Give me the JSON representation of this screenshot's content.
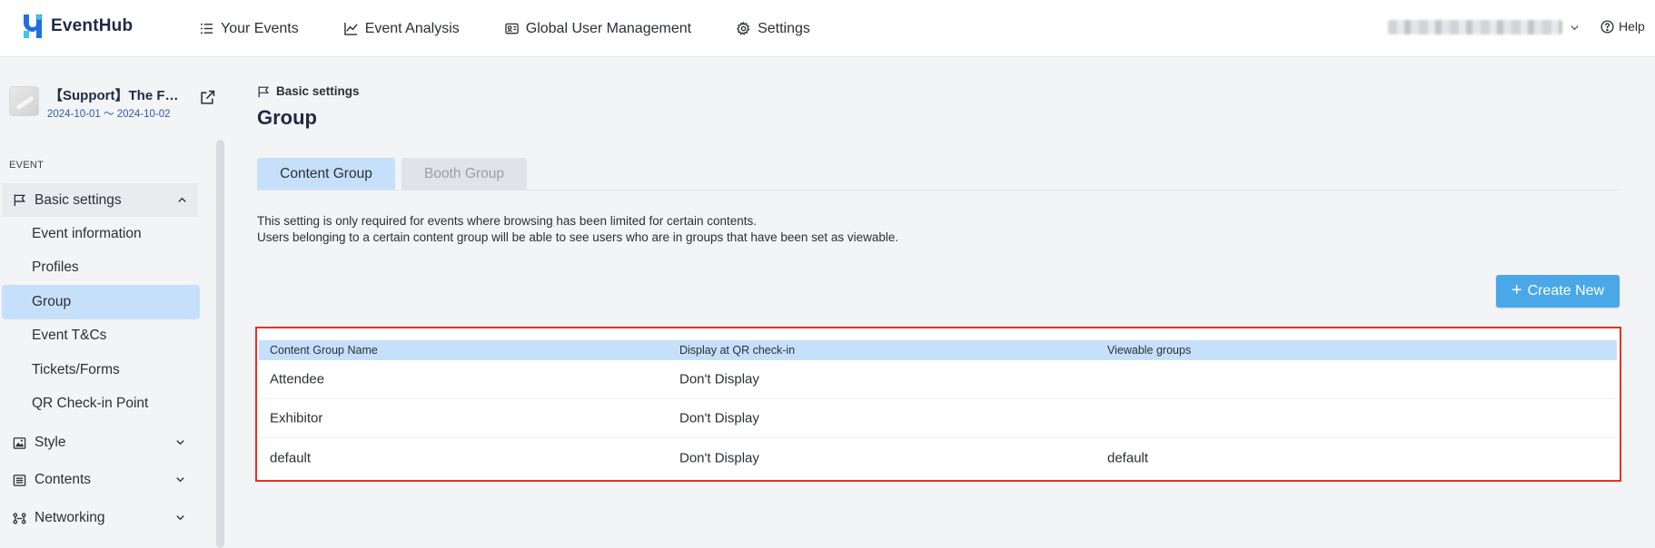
{
  "app": {
    "logo_text": "EventHub"
  },
  "nav": [
    {
      "label": "Your Events",
      "icon": "list-icon"
    },
    {
      "label": "Event Analysis",
      "icon": "chart-line-icon"
    },
    {
      "label": "Global User Management",
      "icon": "id-card-icon"
    },
    {
      "label": "Settings",
      "icon": "gear-icon"
    }
  ],
  "help": {
    "label": "Help"
  },
  "event": {
    "name": "【Support】The F…",
    "dates": "2024-10-01 〜 2024-10-02"
  },
  "sidebar": {
    "section_label": "EVENT",
    "groups": [
      {
        "label": "Basic settings",
        "open": true,
        "items": [
          "Event information",
          "Profiles",
          "Group",
          "Event T&Cs",
          "Tickets/Forms",
          "QR Check-in Point"
        ],
        "active_item": "Group"
      },
      {
        "label": "Style",
        "open": false
      },
      {
        "label": "Contents",
        "open": false
      },
      {
        "label": "Networking",
        "open": false
      }
    ]
  },
  "main": {
    "breadcrumb": "Basic settings",
    "title": "Group",
    "tabs": [
      {
        "label": "Content Group",
        "active": true
      },
      {
        "label": "Booth Group",
        "active": false
      }
    ],
    "description_lines": [
      "This setting is only required for events where browsing has been limited for certain contents.",
      "Users belonging to a certain content group will be able to see users who are in groups that have been set as viewable."
    ],
    "create_button": "Create New",
    "table": {
      "headers": [
        "Content Group Name",
        "Display at QR check-in",
        "Viewable groups"
      ],
      "rows": [
        [
          "Attendee",
          "Don't Display",
          ""
        ],
        [
          "Exhibitor",
          "Don't Display",
          ""
        ],
        [
          "default",
          "Don't Display",
          "default"
        ]
      ]
    }
  },
  "colors": {
    "accent": "#4aa8e8",
    "tab_active": "#c6e0fb",
    "highlight_border": "#e8321e",
    "brand_blue": "#1f6fe0"
  }
}
